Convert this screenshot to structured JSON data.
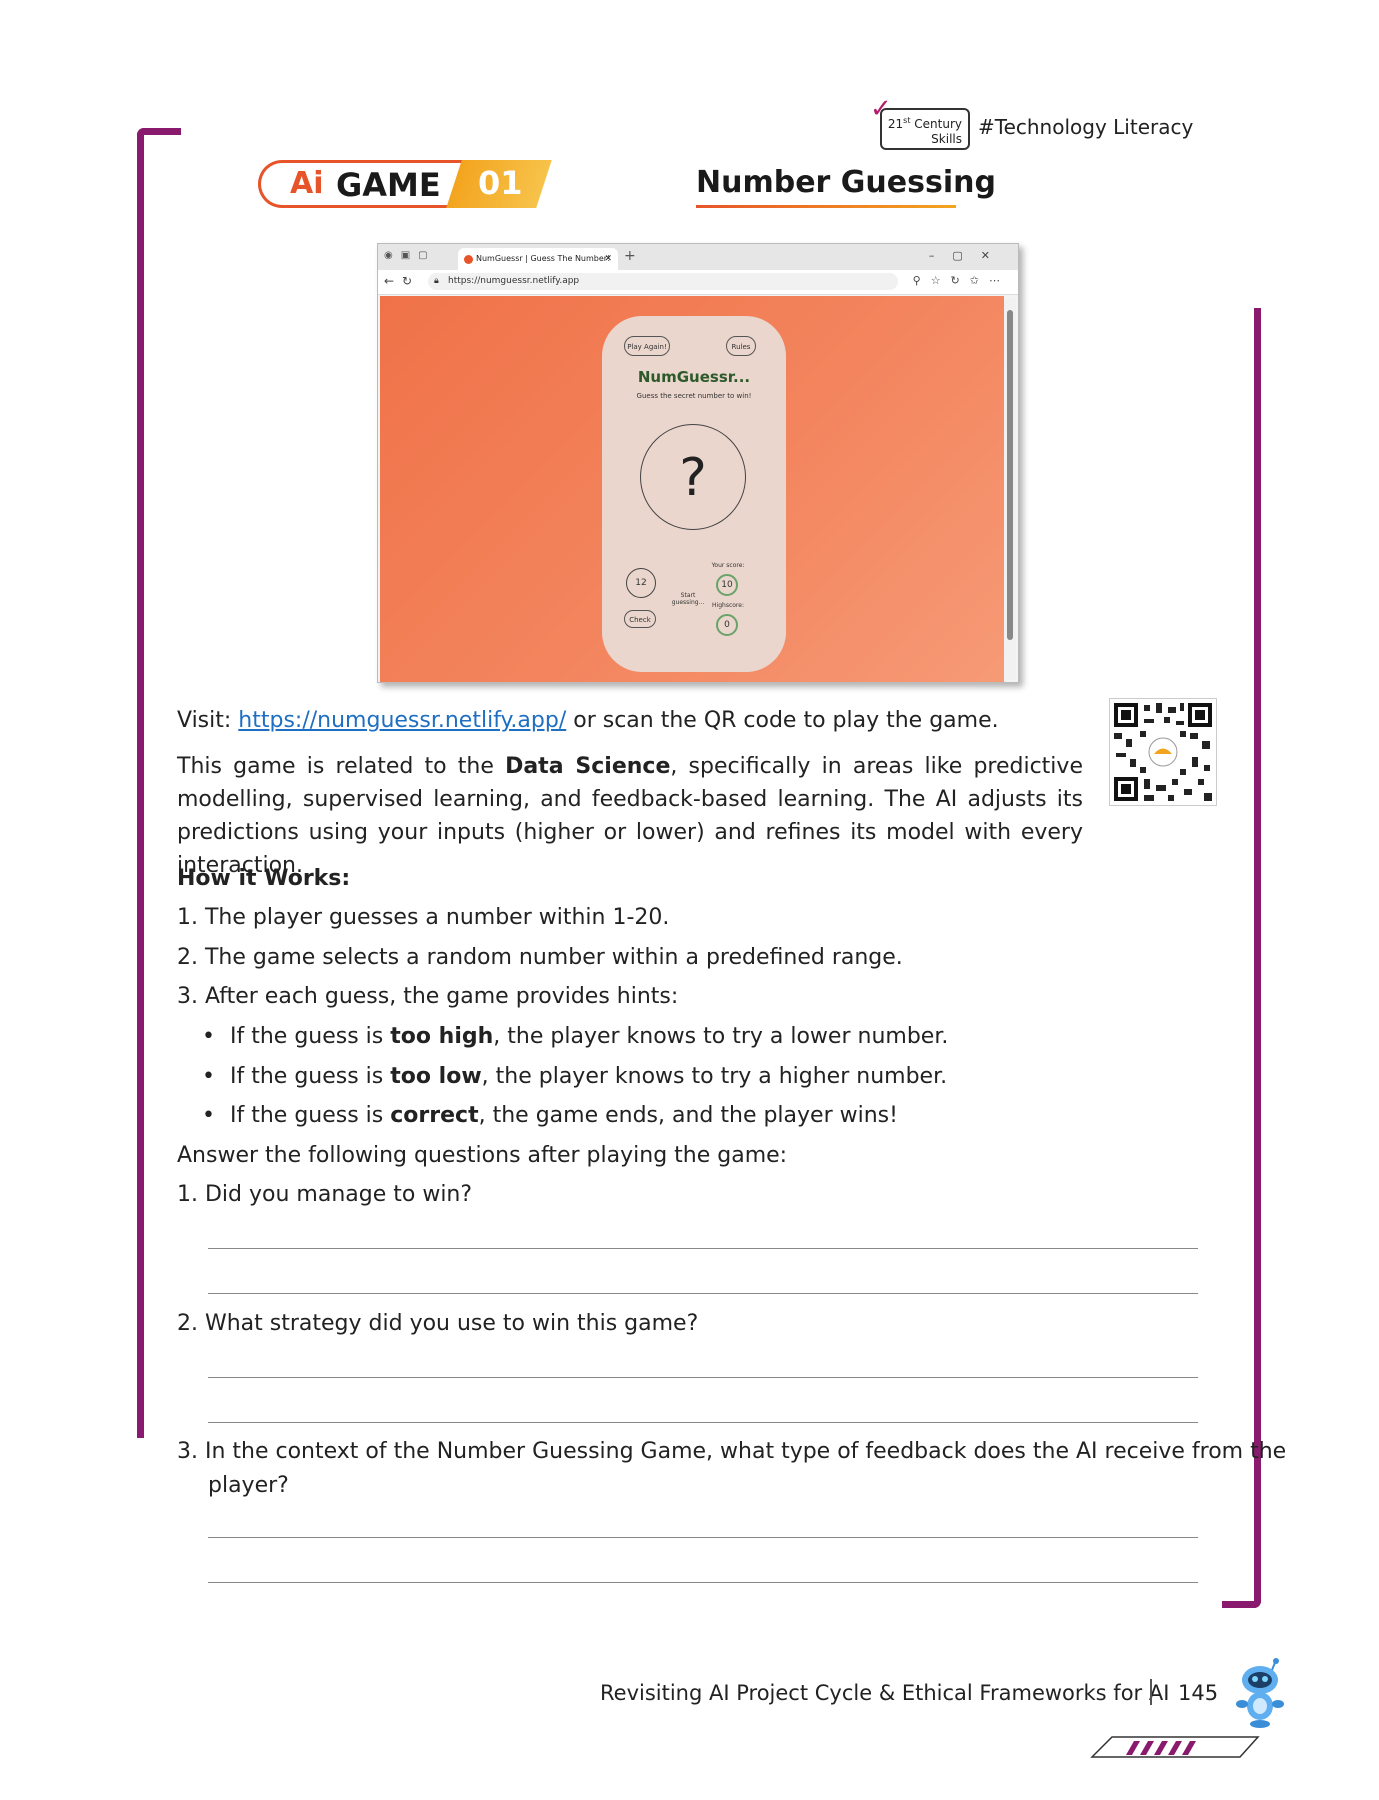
{
  "header": {
    "skills_line1": "21",
    "skills_sup": "st",
    "skills_line1_rest": " Century",
    "skills_line2": "Skills",
    "tag": "#Technology Literacy",
    "badge_ai": "Ai",
    "badge_game": "GAME",
    "badge_number": "01",
    "title": "Number Guessing"
  },
  "browser": {
    "tab_title": "NumGuessr | Guess The Number!",
    "url": "https://numguessr.netlify.app",
    "app": {
      "play_again": "Play Again!",
      "rules": "Rules",
      "title": "NumGuessr...",
      "subtitle": "Guess the secret number to win!",
      "mystery": "?",
      "guess_value": "12",
      "check": "Check",
      "status": "Start guessing...",
      "your_score_label": "Your score:",
      "your_score": "10",
      "highscore_label": "Highscore:",
      "highscore": "0"
    }
  },
  "visit": {
    "prefix": "Visit: ",
    "link": "https://numguessr.netlify.app/",
    "suffix": " or scan the QR code to play the game."
  },
  "intro": {
    "part1": "This game is related to the ",
    "bold": "Data Science",
    "part2": ", specifically in areas like predictive modelling, supervised learning, and feedback-based learning. The AI adjusts its predictions using your inputs (higher or lower) and refines its model with every interaction."
  },
  "how_it_works": {
    "heading": "How it Works:",
    "steps": [
      "1. The player guesses a number within 1-20.",
      "2. The game selects a random number within a predefined range.",
      "3. After each guess, the game provides hints:"
    ],
    "bullets": [
      {
        "pre": "If the guess is ",
        "bold": "too high",
        "post": ", the player knows to try a lower number."
      },
      {
        "pre": "If the guess is ",
        "bold": "too low",
        "post": ", the player knows to try a higher number."
      },
      {
        "pre": "If the guess is ",
        "bold": "correct",
        "post": ", the game ends, and the player wins!"
      }
    ]
  },
  "questions": {
    "intro": "Answer the following questions after playing the game:",
    "items": [
      "1.  Did you manage to win?",
      "2.  What strategy did you use to win this game?",
      "3.  In the context of the Number Guessing Game, what type of feedback does the AI receive from the",
      "player?"
    ]
  },
  "footer": {
    "chapter": "Revisiting AI Project Cycle & Ethical Frameworks for AI",
    "page": "145"
  },
  "colors": {
    "accent_purple": "#8a1a6e",
    "accent_orange": "#e8542a",
    "link_blue": "#1e6fc2"
  }
}
